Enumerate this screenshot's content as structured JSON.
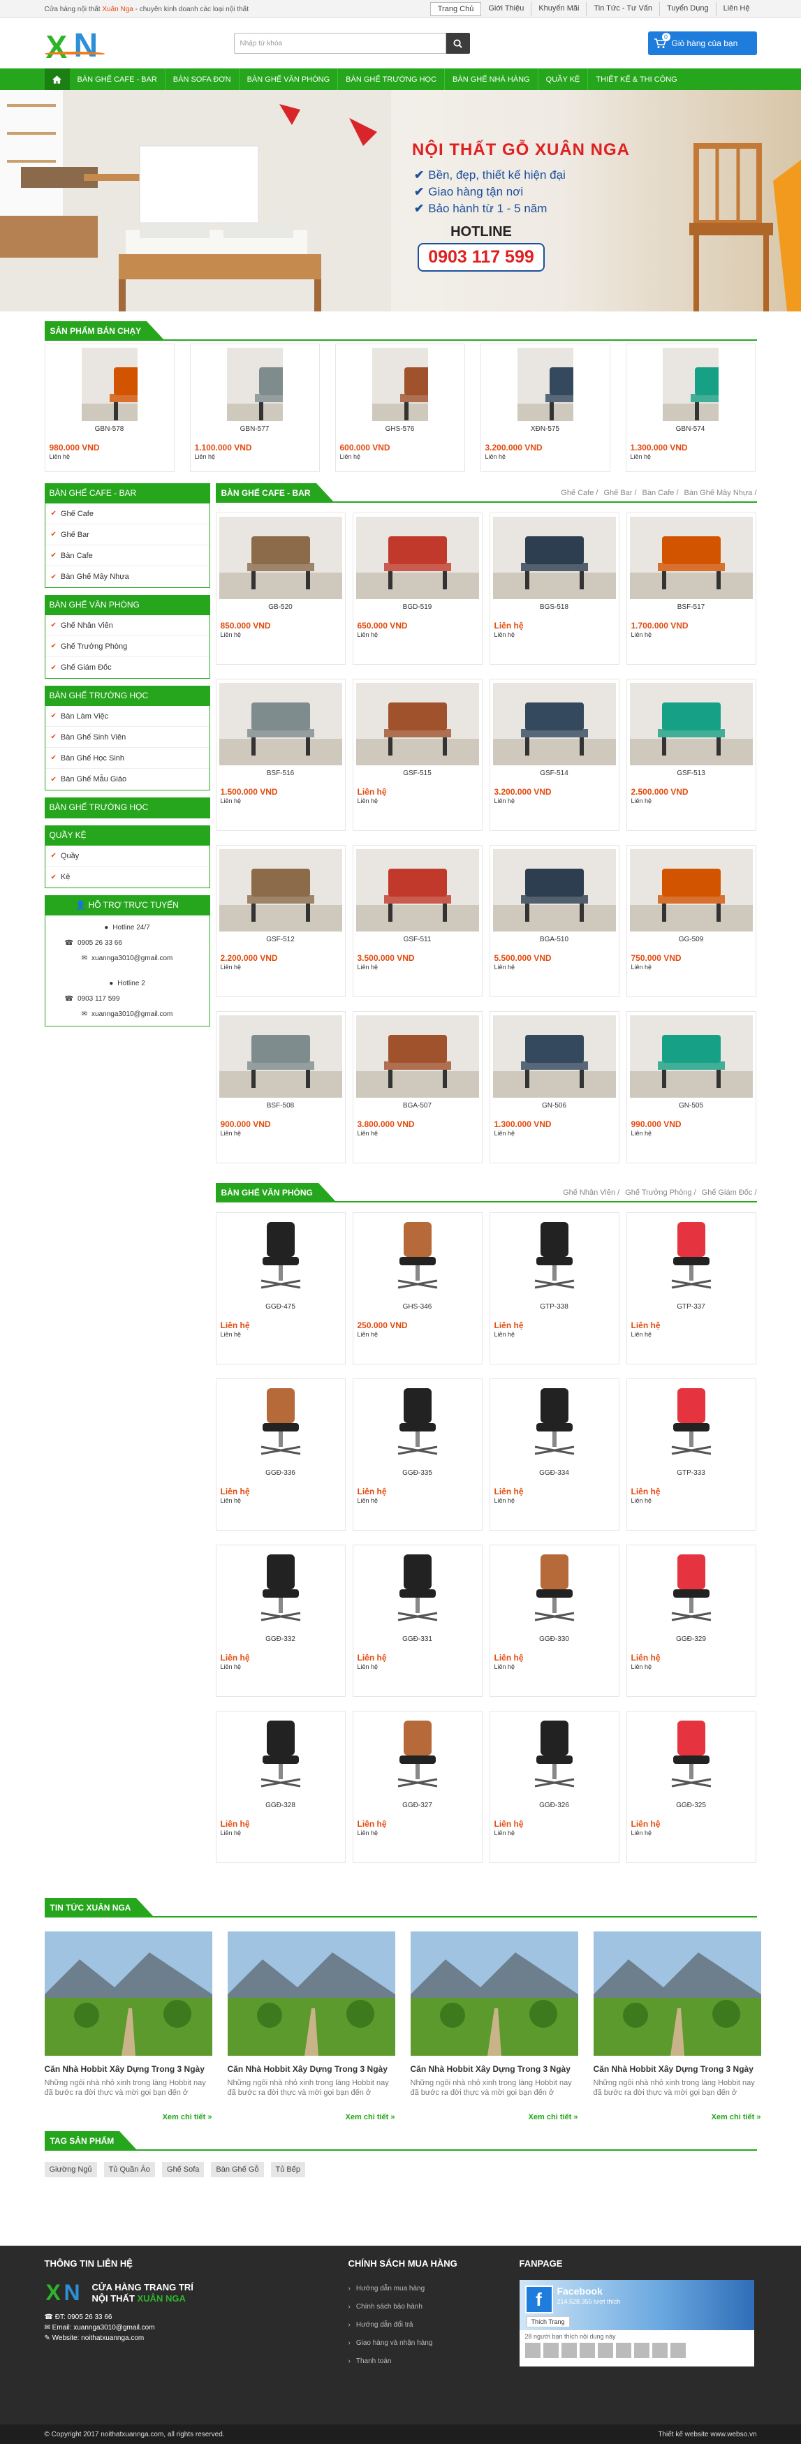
{
  "topbar": {
    "intro_prefix": "Cửa hàng nội thất ",
    "intro_brand": "Xuân Nga",
    "intro_suffix": " - chuyên kinh doanh các loại nội thất",
    "links": [
      "Trang Chủ",
      "Giới Thiệu",
      "Khuyến Mãi",
      "Tin Tức - Tư Vấn",
      "Tuyển Dụng",
      "Liên Hệ"
    ]
  },
  "header": {
    "logo": "XN",
    "search_placeholder": "Nhập từ khóa",
    "cart_label": "Giỏ hàng của bạn",
    "cart_count": "0"
  },
  "nav": [
    "BÀN GHẾ CAFE - BAR",
    "BÀN SOFA ĐƠN",
    "BÀN GHẾ VĂN PHÒNG",
    "BÀN GHẾ TRƯỜNG HỌC",
    "BÀN GHẾ NHÀ HÀNG",
    "QUẦY KỆ",
    "THIẾT KẾ & THI CÔNG"
  ],
  "banner": {
    "title": "NỘI THẤT GỖ XUÂN NGA",
    "bullets": [
      "Bền, đẹp, thiết kế hiện đại",
      "Giao hàng tận nơi",
      "Bảo hành từ 1 - 5 năm"
    ],
    "hotline_label": "HOTLINE",
    "hotline": "0903 117 599"
  },
  "best_sellers": {
    "title": "SẢN PHẨM BÁN CHẠY",
    "items": [
      {
        "code": "GBN-578",
        "price": "980.000 VND",
        "contact": "Liên hệ"
      },
      {
        "code": "GBN-577",
        "price": "1.100.000 VND",
        "contact": "Liên hệ"
      },
      {
        "code": "GHS-576",
        "price": "600.000 VND",
        "contact": "Liên hệ"
      },
      {
        "code": "XĐN-575",
        "price": "3.200.000 VND",
        "contact": "Liên hệ"
      },
      {
        "code": "GBN-574",
        "price": "1.300.000 VND",
        "contact": "Liên hệ"
      }
    ]
  },
  "sidebar": {
    "cafe": {
      "title": "BÀN GHẾ CAFE - BAR",
      "items": [
        "Ghế Cafe",
        "Ghế Bar",
        "Bàn Cafe",
        "Bàn Ghế Mây Nhựa"
      ]
    },
    "office": {
      "title": "BÀN GHẾ VĂN PHÒNG",
      "items": [
        "Ghế Nhân Viên",
        "Ghế Trưởng Phòng",
        "Ghế Giám Đốc"
      ]
    },
    "school": {
      "title": "BÀN GHẾ TRƯỜNG HỌC",
      "items": [
        "Bàn Làm Việc",
        "Bàn Ghế Sinh Viên",
        "Bàn Ghế Học Sinh",
        "Bàn Ghế Mẫu Giáo"
      ]
    },
    "school2": {
      "title": "BÀN GHẾ TRƯỜNG HỌC"
    },
    "shelf": {
      "title": "QUẦY KỆ",
      "items": [
        "Quầy",
        "Kệ"
      ]
    },
    "support": {
      "title": "HỖ TRỢ TRỰC TUYẾN",
      "hotline1": "Hotline 24/7",
      "phone1": "0905 26 33 66",
      "email1": "xuannga3010@gmail.com",
      "hotline2": "Hotline 2",
      "phone2": "0903 117 599",
      "email2": "xuannga3010@gmail.com"
    }
  },
  "cafe_section": {
    "title": "BÀN GHẾ CAFE - BAR",
    "cats": [
      "Ghế Cafe /",
      "Ghế Bar /",
      "Bàn Cafe /",
      "Bàn Ghế Mây Nhựa /"
    ],
    "items": [
      {
        "code": "GB-520",
        "price": "850.000 VND",
        "contact": "Liên hệ"
      },
      {
        "code": "BGD-519",
        "price": "650.000 VND",
        "contact": "Liên hệ"
      },
      {
        "code": "BGS-518",
        "price": "Liên hệ",
        "contact": "Liên hệ"
      },
      {
        "code": "BSF-517",
        "price": "1.700.000 VND",
        "contact": "Liên hệ"
      },
      {
        "code": "BSF-516",
        "price": "1.500.000 VND",
        "contact": "Liên hệ"
      },
      {
        "code": "GSF-515",
        "price": "Liên hệ",
        "contact": "Liên hệ"
      },
      {
        "code": "GSF-514",
        "price": "3.200.000 VND",
        "contact": "Liên hệ"
      },
      {
        "code": "GSF-513",
        "price": "2.500.000 VND",
        "contact": "Liên hệ"
      },
      {
        "code": "GSF-512",
        "price": "2.200.000 VND",
        "contact": "Liên hệ"
      },
      {
        "code": "GSF-511",
        "price": "3.500.000 VND",
        "contact": "Liên hệ"
      },
      {
        "code": "BGA-510",
        "price": "5.500.000 VND",
        "contact": "Liên hệ"
      },
      {
        "code": "GG-509",
        "price": "750.000 VND",
        "contact": "Liên hệ"
      },
      {
        "code": "BSF-508",
        "price": "900.000 VND",
        "contact": "Liên hệ"
      },
      {
        "code": "BGA-507",
        "price": "3.800.000 VND",
        "contact": "Liên hệ"
      },
      {
        "code": "GN-506",
        "price": "1.300.000 VND",
        "contact": "Liên hệ"
      },
      {
        "code": "GN-505",
        "price": "990.000 VND",
        "contact": "Liên hệ"
      }
    ]
  },
  "office_section": {
    "title": "BÀN GHẾ VĂN PHÒNG",
    "cats": [
      "Ghế Nhân Viên /",
      "Ghế Trưởng Phòng /",
      "Ghế Giám Đốc /"
    ],
    "items": [
      {
        "code": "GGĐ-475",
        "price": "Liên hệ",
        "contact": "Liên hệ"
      },
      {
        "code": "GHS-346",
        "price": "250.000 VND",
        "contact": "Liên hệ"
      },
      {
        "code": "GTP-338",
        "price": "Liên hệ",
        "contact": "Liên hệ"
      },
      {
        "code": "GTP-337",
        "price": "Liên hệ",
        "contact": "Liên hệ"
      },
      {
        "code": "GGĐ-336",
        "price": "Liên hệ",
        "contact": "Liên hệ"
      },
      {
        "code": "GGĐ-335",
        "price": "Liên hệ",
        "contact": "Liên hệ"
      },
      {
        "code": "GGĐ-334",
        "price": "Liên hệ",
        "contact": "Liên hệ"
      },
      {
        "code": "GTP-333",
        "price": "Liên hệ",
        "contact": "Liên hệ"
      },
      {
        "code": "GGĐ-332",
        "price": "Liên hệ",
        "contact": "Liên hệ"
      },
      {
        "code": "GGĐ-331",
        "price": "Liên hệ",
        "contact": "Liên hệ"
      },
      {
        "code": "GGĐ-330",
        "price": "Liên hệ",
        "contact": "Liên hệ"
      },
      {
        "code": "GGĐ-329",
        "price": "Liên hệ",
        "contact": "Liên hệ"
      },
      {
        "code": "GGĐ-328",
        "price": "Liên hệ",
        "contact": "Liên hệ"
      },
      {
        "code": "GGĐ-327",
        "price": "Liên hệ",
        "contact": "Liên hệ"
      },
      {
        "code": "GGĐ-326",
        "price": "Liên hệ",
        "contact": "Liên hệ"
      },
      {
        "code": "GGĐ-325",
        "price": "Liên hệ",
        "contact": "Liên hệ"
      }
    ]
  },
  "news": {
    "title": "TIN TỨC XUÂN NGA",
    "items": [
      {
        "title": "Căn Nhà Hobbit Xây Dựng Trong 3 Ngày",
        "desc": "Những ngôi nhà nhỏ xinh trong làng Hobbit nay đã bước ra đời thực và mời gọi bạn đến ở",
        "more": "Xem chi tiết »"
      },
      {
        "title": "Căn Nhà Hobbit Xây Dựng Trong 3 Ngày",
        "desc": "Những ngôi nhà nhỏ xinh trong làng Hobbit nay đã bước ra đời thực và mời gọi bạn đến ở",
        "more": "Xem chi tiết »"
      },
      {
        "title": "Căn Nhà Hobbit Xây Dựng Trong 3 Ngày",
        "desc": "Những ngôi nhà nhỏ xinh trong làng Hobbit nay đã bước ra đời thực và mời gọi bạn đến ở",
        "more": "Xem chi tiết »"
      },
      {
        "title": "Căn Nhà Hobbit Xây Dựng Trong 3 Ngày",
        "desc": "Những ngôi nhà nhỏ xinh trong làng Hobbit nay đã bước ra đời thực và mời gọi bạn đến ở",
        "more": "Xem chi tiết »"
      }
    ]
  },
  "tags": {
    "title": "TAG SẢN PHẨM",
    "items": [
      "Giường Ngủ",
      "Tủ Quần Áo",
      "Ghế Sofa",
      "Bàn Ghế Gỗ",
      "Tủ Bếp"
    ]
  },
  "footer": {
    "contact_title": "THÔNG TIN LIÊN HỆ",
    "store_line1": "CỬA HÀNG TRANG TRÍ",
    "store_line2_prefix": "NỘI THẤT ",
    "store_line2_brand": "XUÂN NGA",
    "phone": "ĐT: 0905 26 33 66",
    "email": "Email: xuannga3010@gmail.com",
    "website": "Website: noithatxuannga.com",
    "policy_title": "CHÍNH SÁCH MUA HÀNG",
    "policies": [
      "Hướng dẫn mua hàng",
      "Chính sách bảo hành",
      "Hướng dẫn đổi trả",
      "Giao hàng và nhận hàng",
      "Thanh toán"
    ],
    "fanpage_title": "FANPAGE",
    "fb_name": "Facebook",
    "fb_likes": "214.528.355 lượt thích",
    "fb_like_btn": "Thích Trang",
    "fb_friends": "28 người bạn thích nội dung này",
    "copyright": "© Copyright 2017 noithatxuannga.com, all rights reserved.",
    "credit": "Thiết kế website www.webso.vn"
  },
  "colors": {
    "green": "#26a61d",
    "orange": "#e44b0e",
    "blue": "#1e7ddc",
    "dark": "#2b2b2b"
  }
}
